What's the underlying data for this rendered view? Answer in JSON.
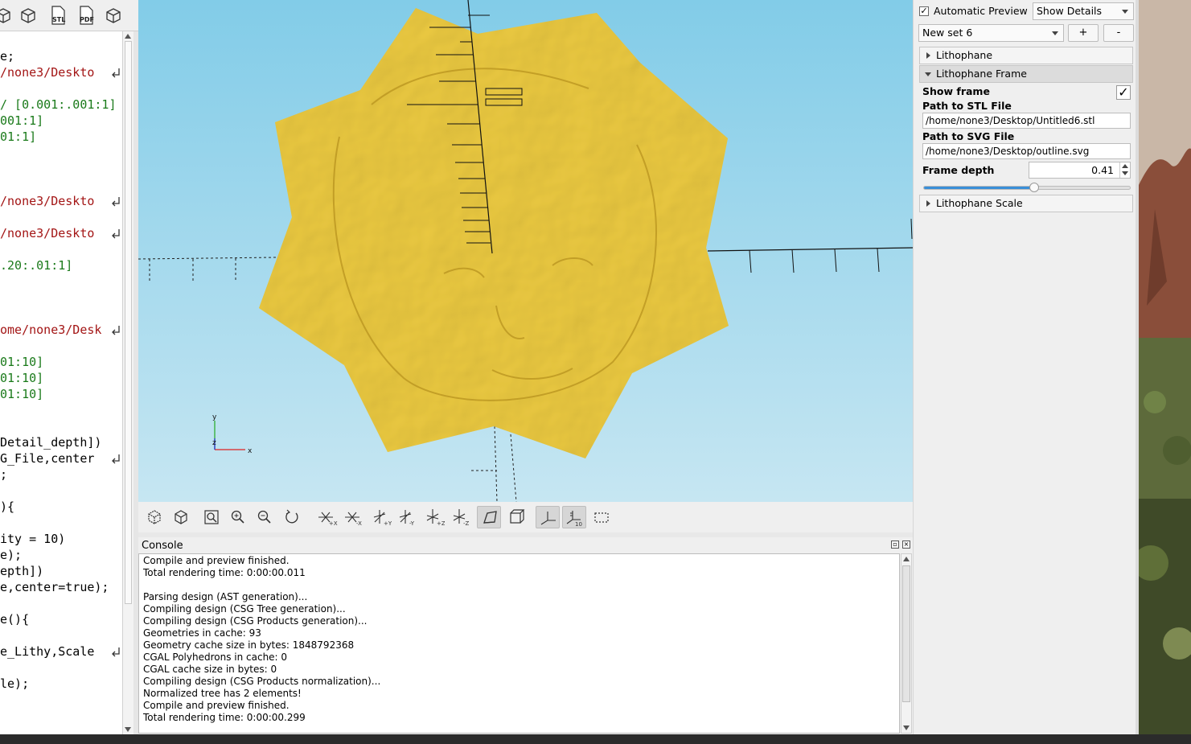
{
  "toolbar": {
    "icons": [
      "view-preview-icon",
      "render-icon",
      "export-stl-icon",
      "export-pdf-icon",
      "export-3d-icon"
    ],
    "stl_label": "STL",
    "pdf_label": "PDF"
  },
  "editor": {
    "lines": [
      {
        "text": "e;",
        "color": "#000000"
      },
      {
        "text": "/none3/Deskto",
        "color": "#a31515",
        "wrap": true
      },
      {
        "text": "",
        "color": "#000000"
      },
      {
        "text": "/ [0.001:.001:1]",
        "color": "#1a7a1a"
      },
      {
        "text": "001:1]",
        "color": "#1a7a1a"
      },
      {
        "text": "01:1]",
        "color": "#1a7a1a"
      },
      {
        "text": "",
        "color": "#000000"
      },
      {
        "text": "",
        "color": "#000000"
      },
      {
        "text": "",
        "color": "#000000"
      },
      {
        "text": "/none3/Deskto",
        "color": "#a31515",
        "wrap": true
      },
      {
        "text": "",
        "color": "#000000"
      },
      {
        "text": "/none3/Deskto",
        "color": "#a31515",
        "wrap": true
      },
      {
        "text": "",
        "color": "#000000"
      },
      {
        "text": ".20:.01:1]",
        "color": "#1a7a1a"
      },
      {
        "text": "",
        "color": "#000000"
      },
      {
        "text": "",
        "color": "#000000"
      },
      {
        "text": "",
        "color": "#000000"
      },
      {
        "text": "ome/none3/Desk",
        "color": "#a31515",
        "wrap": true
      },
      {
        "text": "",
        "color": "#000000"
      },
      {
        "text": "01:10]",
        "color": "#1a7a1a"
      },
      {
        "text": "01:10]",
        "color": "#1a7a1a"
      },
      {
        "text": "01:10]",
        "color": "#1a7a1a"
      },
      {
        "text": "",
        "color": "#000000"
      },
      {
        "text": "",
        "color": "#000000"
      },
      {
        "text": "Detail_depth])",
        "color": "#000000"
      },
      {
        "text": "G_File,center",
        "color": "#000000",
        "wrap": true
      },
      {
        "text": ";",
        "color": "#000000"
      },
      {
        "text": "",
        "color": "#000000"
      },
      {
        "text": "){",
        "color": "#000000"
      },
      {
        "text": "",
        "color": "#000000"
      },
      {
        "text": "ity = 10)",
        "color": "#000000"
      },
      {
        "text": "e);",
        "color": "#000000"
      },
      {
        "text": "epth])",
        "color": "#000000"
      },
      {
        "text": "e,center=true);",
        "color": "#000000"
      },
      {
        "text": "",
        "color": "#000000"
      },
      {
        "text": "e(){",
        "color": "#000000"
      },
      {
        "text": "",
        "color": "#000000"
      },
      {
        "text": "e_Lithy,Scale",
        "color": "#000000",
        "wrap": true
      },
      {
        "text": "",
        "color": "#000000"
      },
      {
        "text": "le);",
        "color": "#000000"
      }
    ]
  },
  "viewport": {
    "model_color": "#e9c43a",
    "background_top": "#82cce8",
    "background_bottom": "#c6e6f2",
    "axis_labels": {
      "x": "x",
      "y": "y",
      "z": "z"
    }
  },
  "view_toolbar": {
    "buttons": [
      "preview-icon",
      "render-icon",
      "view-all-icon",
      "zoom-in-icon",
      "zoom-out-icon",
      "reset-view-icon",
      "view-right-icon",
      "view-left-icon",
      "view-back-icon",
      "view-front-icon",
      "view-top-icon",
      "view-bottom-icon",
      "perspective-icon",
      "orthogonal-icon",
      "show-axes-icon",
      "show-scale-markers-icon",
      "show-edges-icon"
    ],
    "active": [
      "perspective-icon",
      "show-axes-icon",
      "show-scale-markers-icon"
    ]
  },
  "console": {
    "title": "Console",
    "lines": [
      "Compile and preview finished.",
      "Total rendering time: 0:00:00.011",
      "",
      "Parsing design (AST generation)...",
      "Compiling design (CSG Tree generation)...",
      "Compiling design (CSG Products generation)...",
      "Geometries in cache: 93",
      "Geometry cache size in bytes: 1848792368",
      "CGAL Polyhedrons in cache: 0",
      "CGAL cache size in bytes: 0",
      "Compiling design (CSG Products normalization)...",
      "Normalized tree has 2 elements!",
      "Compile and preview finished.",
      "Total rendering time: 0:00:00.299"
    ]
  },
  "customizer": {
    "auto_preview_label": "Automatic Preview",
    "auto_preview_checked": true,
    "details_select": "Show Details",
    "preset_select": "New set 6",
    "add_label": "+",
    "remove_label": "-",
    "groups": {
      "lithophane": "Lithophane",
      "frame": "Lithophane Frame",
      "scale": "Lithophane Scale"
    },
    "fields": {
      "show_frame_label": "Show frame",
      "show_frame_checked": true,
      "stl_label": "Path to STL File",
      "stl_value": "/home/none3/Desktop/Untitled6.stl",
      "svg_label": "Path to SVG File",
      "svg_value": "/home/none3/Desktop/outline.svg",
      "depth_label": "Frame depth",
      "depth_value": "0.41",
      "depth_slider_fraction": 0.41
    }
  }
}
